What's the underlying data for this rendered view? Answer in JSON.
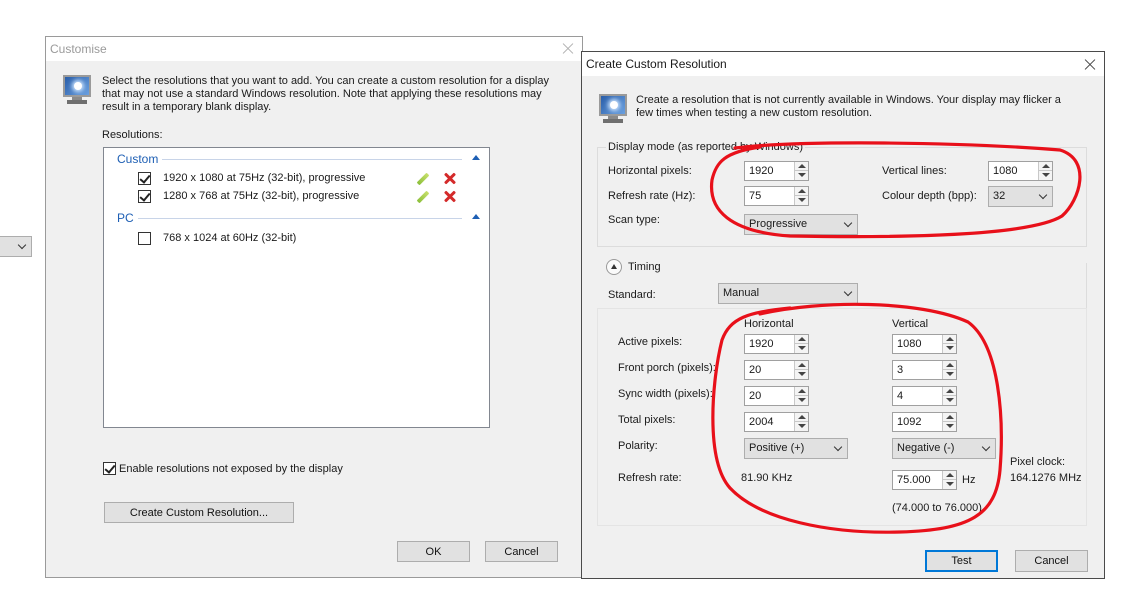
{
  "left_stub": {
    "value": ""
  },
  "customise": {
    "title": "Customise",
    "intro": "Select the resolutions that you want to add. You can create a custom resolution for a display that may not use a standard Windows resolution. Note that applying these resolutions may result in a temporary blank display.",
    "resolutions_label": "Resolutions:",
    "groups": [
      {
        "name": "Custom",
        "items": [
          {
            "label": "1920 x 1080 at 75Hz (32-bit), progressive",
            "checked": true
          },
          {
            "label": "1280 x 768 at 75Hz (32-bit), progressive",
            "checked": true
          }
        ]
      },
      {
        "name": "PC",
        "items": [
          {
            "label": "768 x 1024 at 60Hz (32-bit)",
            "checked": false
          }
        ]
      }
    ],
    "enable_label": "Enable resolutions not exposed by the display",
    "create_button": "Create Custom Resolution...",
    "ok_button": "OK",
    "cancel_button": "Cancel"
  },
  "ccr": {
    "title": "Create Custom Resolution",
    "intro": "Create a resolution that is not currently available in Windows. Your display may flicker a few times when testing a new custom resolution.",
    "display_mode_label": "Display mode (as reported by Windows)",
    "horizontal_pixels_label": "Horizontal pixels:",
    "horizontal_pixels": "1920",
    "vertical_lines_label": "Vertical lines:",
    "vertical_lines": "1080",
    "refresh_rate_label": "Refresh rate (Hz):",
    "refresh_rate": "75",
    "colour_depth_label": "Colour depth (bpp):",
    "colour_depth": "32",
    "scan_type_label": "Scan type:",
    "scan_type": "Progressive",
    "timing_label": "Timing",
    "standard_label": "Standard:",
    "standard": "Manual",
    "col_horizontal": "Horizontal",
    "col_vertical": "Vertical",
    "rows": [
      {
        "label": "Active pixels:",
        "h": "1920",
        "v": "1080"
      },
      {
        "label": "Front porch (pixels):",
        "h": "20",
        "v": "3"
      },
      {
        "label": "Sync width (pixels):",
        "h": "20",
        "v": "4"
      },
      {
        "label": "Total pixels:",
        "h": "2004",
        "v": "1092"
      }
    ],
    "polarity_label": "Polarity:",
    "polarity_h": "Positive (+)",
    "polarity_v": "Negative (-)",
    "refresh_rate2_label": "Refresh rate:",
    "h_refresh": "81.90 KHz",
    "v_refresh": "75.000",
    "hz_unit": "Hz",
    "range": "(74.000 to 76.000)",
    "pixel_clock_label": "Pixel clock:",
    "pixel_clock": "164.1276 MHz",
    "test_button": "Test",
    "cancel_button": "Cancel"
  },
  "colors": {
    "annotation": "#e8101a",
    "link_blue": "#1e5fb4",
    "focus_blue": "#0078d7"
  }
}
